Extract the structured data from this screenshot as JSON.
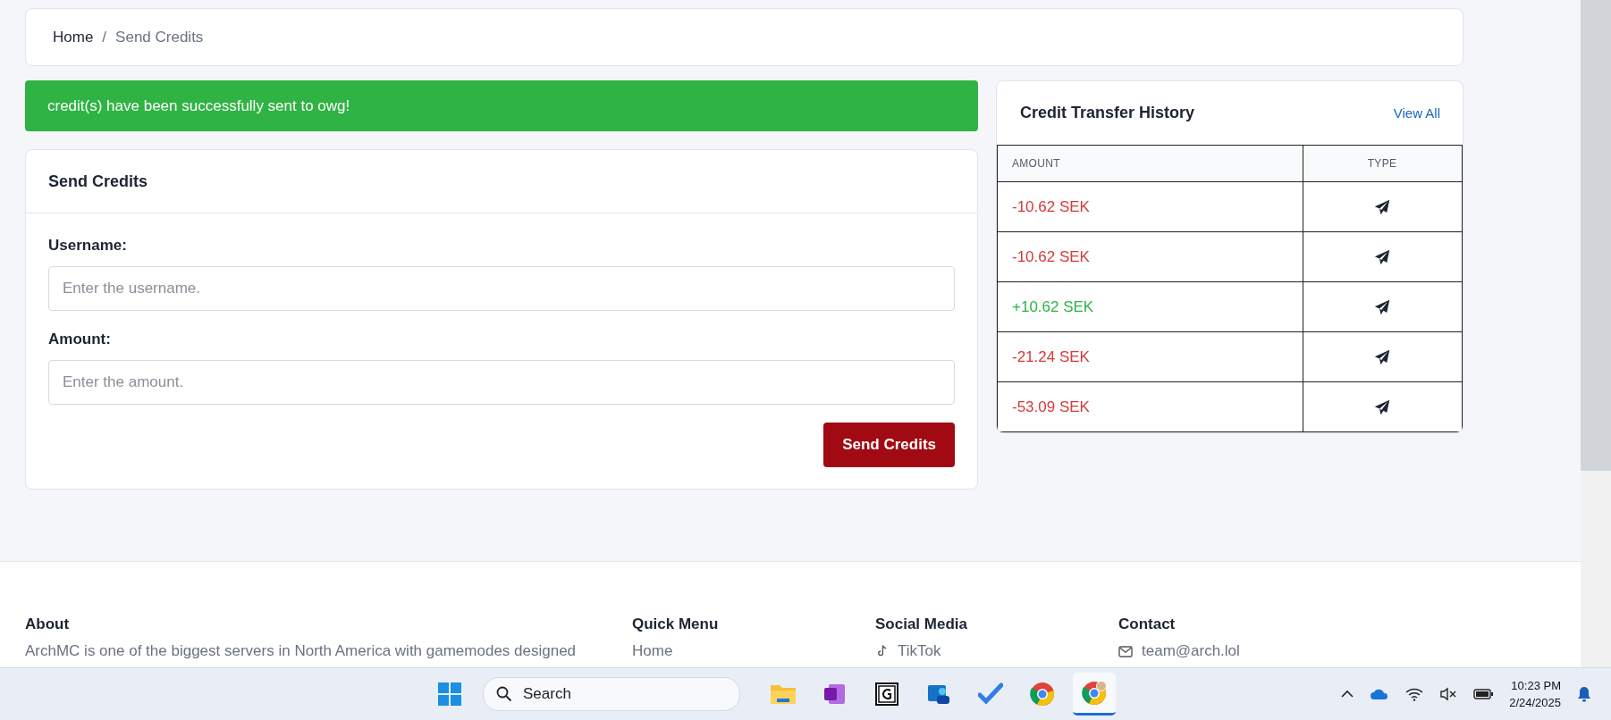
{
  "breadcrumb": {
    "items": [
      {
        "label": "Home",
        "current": false
      },
      {
        "label": "Send Credits",
        "current": true
      }
    ],
    "separator": "/"
  },
  "alert": {
    "text": "credit(s) have been successfully sent to owg!"
  },
  "send_form": {
    "title": "Send Credits",
    "fields": [
      {
        "label": "Username:",
        "placeholder": "Enter the username."
      },
      {
        "label": "Amount:",
        "placeholder": "Enter the amount."
      }
    ],
    "button": "Send Credits"
  },
  "history": {
    "title": "Credit Transfer History",
    "link": "View All",
    "columns": [
      "AMOUNT",
      "TYPE"
    ],
    "rows": [
      {
        "amount": "-10.62 SEK",
        "kind": "debit"
      },
      {
        "amount": "-10.62 SEK",
        "kind": "debit"
      },
      {
        "amount": "+10.62 SEK",
        "kind": "credit"
      },
      {
        "amount": "-21.24 SEK",
        "kind": "debit"
      },
      {
        "amount": "-53.09 SEK",
        "kind": "debit"
      }
    ]
  },
  "footer": {
    "columns": [
      {
        "heading": "About",
        "item": {
          "kind": "text",
          "text": "ArchMC is one of the biggest servers in North America with gamemodes designed"
        }
      },
      {
        "heading": "Quick Menu",
        "item": {
          "kind": "link",
          "text": "Home"
        }
      },
      {
        "heading": "Social Media",
        "item": {
          "kind": "tiktok",
          "text": "TikTok"
        }
      },
      {
        "heading": "Contact",
        "item": {
          "kind": "email",
          "text": "team@arch.lol"
        }
      }
    ]
  },
  "taskbar": {
    "search_placeholder": "Search",
    "apps": [
      {
        "kind": "folder",
        "active": false
      },
      {
        "kind": "notebook",
        "active": false
      },
      {
        "kind": "framed",
        "active": false
      },
      {
        "kind": "people",
        "active": false
      },
      {
        "kind": "check",
        "active": false
      },
      {
        "kind": "browser",
        "active": false
      },
      {
        "kind": "browser-profile",
        "active": true
      }
    ],
    "time": "10:23 PM",
    "date": "2/24/2025"
  }
}
